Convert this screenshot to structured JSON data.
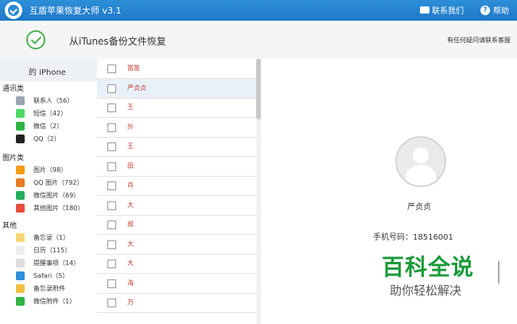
{
  "titlebar": {
    "title": "互盾苹果恢复大师 v3.1",
    "contact": "联系我们",
    "help": "帮助"
  },
  "header": {
    "title": "从iTunes备份文件恢复",
    "note": "有任何疑问请联系客服"
  },
  "device": {
    "label": "的 iPhone"
  },
  "categories": [
    {
      "label": "通讯类",
      "items": [
        {
          "label": "联系人（56）",
          "icon": "contacts-icon",
          "color": "#9aa5b1"
        },
        {
          "label": "短信（42）",
          "icon": "sms-icon",
          "color": "#4cd964"
        },
        {
          "label": "微信（2）",
          "icon": "wechat-icon",
          "color": "#2fb344"
        },
        {
          "label": "QQ（2）",
          "icon": "qq-icon",
          "color": "#222222"
        }
      ]
    },
    {
      "label": "图片类",
      "items": [
        {
          "label": "图片（98）",
          "icon": "photos-icon",
          "color": "#f39c12"
        },
        {
          "label": "QQ 图片（792）",
          "icon": "qq-photos-icon",
          "color": "#e67e22"
        },
        {
          "label": "微信图片（69）",
          "icon": "wechat-photos-icon",
          "color": "#27ae60"
        },
        {
          "label": "其他图片（180）",
          "icon": "other-photos-icon",
          "color": "#e74c3c"
        }
      ]
    },
    {
      "label": "其他",
      "items": [
        {
          "label": "备忘录（1）",
          "icon": "notes-icon",
          "color": "#f7d774"
        },
        {
          "label": "日历（115）",
          "icon": "calendar-icon",
          "color": "#eeeeee"
        },
        {
          "label": "提醒事项（14）",
          "icon": "reminders-icon",
          "color": "#dddddd"
        },
        {
          "label": "Safari（5）",
          "icon": "safari-icon",
          "color": "#2d8fd8"
        },
        {
          "label": "备忘录附件",
          "icon": "notes-attachment-icon",
          "color": "#f0c040"
        },
        {
          "label": "微信附件（1）",
          "icon": "wechat-attachment-icon",
          "color": "#2fb344"
        }
      ]
    }
  ],
  "contacts": [
    {
      "name": "笛笛",
      "selected": false
    },
    {
      "name": "严贞贞",
      "selected": true
    },
    {
      "name": "王",
      "selected": false
    },
    {
      "name": "外",
      "selected": false
    },
    {
      "name": "王",
      "selected": false
    },
    {
      "name": "田",
      "selected": false
    },
    {
      "name": "肖",
      "selected": false
    },
    {
      "name": "大",
      "selected": false
    },
    {
      "name": "叔",
      "selected": false
    },
    {
      "name": "大",
      "selected": false
    },
    {
      "name": "大",
      "selected": false
    },
    {
      "name": "海",
      "selected": false
    },
    {
      "name": "万",
      "selected": false
    }
  ],
  "detail": {
    "name": "严贞贞",
    "phone": "手机号码：18516001"
  },
  "watermark": {
    "title": "百科全说",
    "subtitle": "助你轻松解决"
  }
}
